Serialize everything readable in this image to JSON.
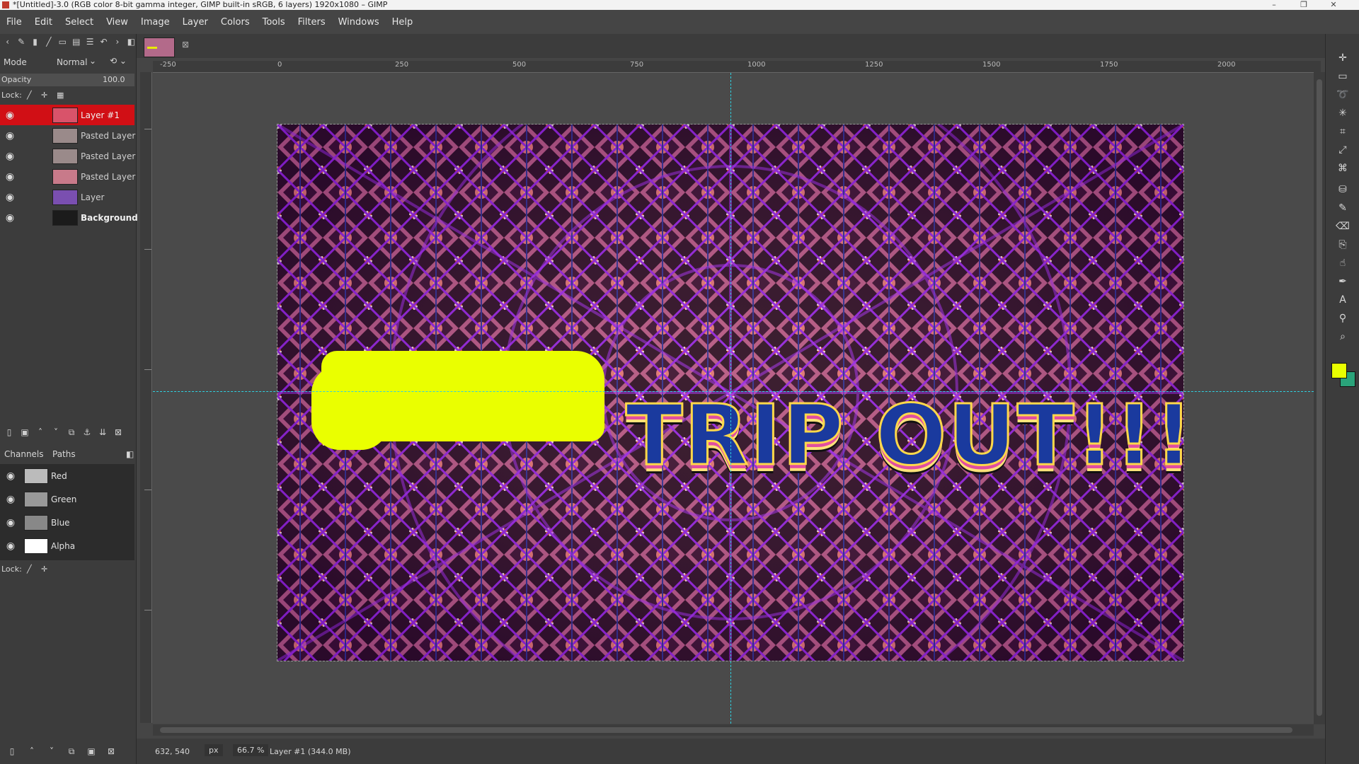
{
  "window": {
    "title": "*[Untitled]-3.0 (RGB color 8-bit gamma integer, GIMP built-in sRGB, 6 layers) 1920x1080 – GIMP",
    "controls": [
      "–",
      "❐",
      "✕"
    ]
  },
  "menubar": [
    "File",
    "Edit",
    "Select",
    "View",
    "Image",
    "Layer",
    "Colors",
    "Tools",
    "Filters",
    "Windows",
    "Help"
  ],
  "layers_panel": {
    "mode_label": "Mode",
    "mode_value": "Normal",
    "opacity_label": "Opacity",
    "opacity_value": "100.0",
    "lock_label": "Lock:",
    "layers": [
      {
        "name": "Layer #1",
        "active": true,
        "thumb_color": "#d9536a"
      },
      {
        "name": "Pasted Layer",
        "active": false,
        "thumb_color": "#9a8a8a"
      },
      {
        "name": "Pasted Layer",
        "active": false,
        "thumb_color": "#9a8a8a"
      },
      {
        "name": "Pasted Layer",
        "active": false,
        "thumb_color": "#c87a8a"
      },
      {
        "name": "Layer",
        "active": false,
        "thumb_color": "#7a4fb0"
      },
      {
        "name": "Background",
        "active": false,
        "thumb_color": "#1b1b1b",
        "bold": true
      }
    ]
  },
  "channels_panel": {
    "tabs": [
      "Channels",
      "Paths"
    ],
    "channels": [
      {
        "name": "Red",
        "thumb_color": "#bbbbbb"
      },
      {
        "name": "Green",
        "thumb_color": "#999999"
      },
      {
        "name": "Blue",
        "thumb_color": "#888888"
      },
      {
        "name": "Alpha",
        "thumb_color": "#ffffff"
      }
    ],
    "lock_label": "Lock:"
  },
  "canvas": {
    "art_text": "TRIP OUT!!!"
  },
  "rulers": {
    "h_labels": [
      "-250",
      "0",
      "250",
      "500",
      "750",
      "1000",
      "1250",
      "1500",
      "1750",
      "2000"
    ]
  },
  "statusbar": {
    "coords": "632, 540",
    "unit": "px",
    "zoom": "66.7 %",
    "message": "Layer #1 (344.0 MB)"
  },
  "colors": {
    "accent_red": "#d10f15",
    "foreground": "#eaff00",
    "background": "#2aa37a",
    "guide": "#2fd0e0"
  }
}
